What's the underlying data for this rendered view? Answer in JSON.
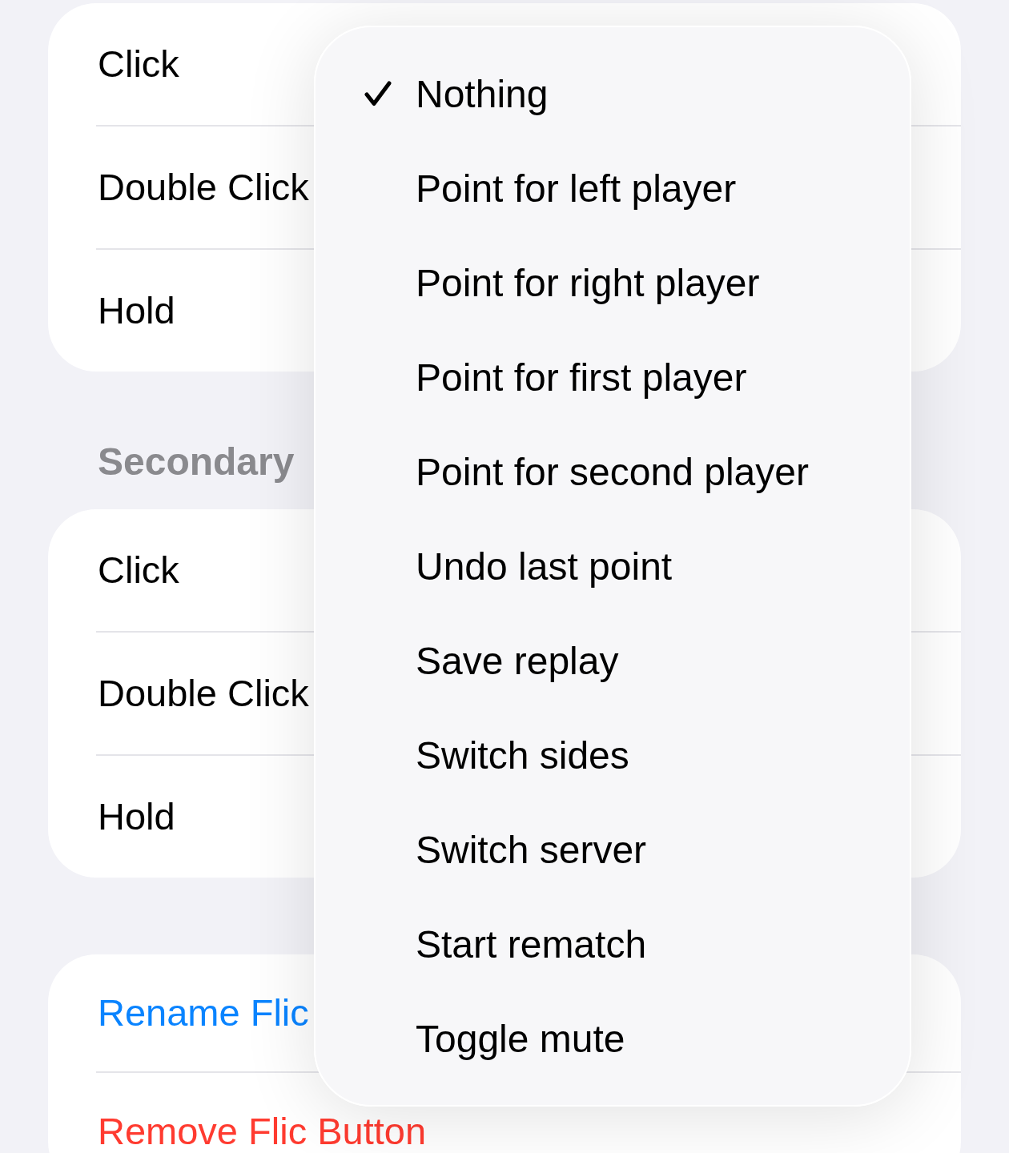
{
  "sections": [
    {
      "rows": [
        {
          "label": "Click",
          "kind": "option"
        },
        {
          "label": "Double Click",
          "kind": "option"
        },
        {
          "label": "Hold",
          "kind": "option"
        }
      ]
    },
    {
      "header": "Secondary",
      "rows": [
        {
          "label": "Click",
          "kind": "option"
        },
        {
          "label": "Double Click",
          "kind": "option"
        },
        {
          "label": "Hold",
          "kind": "option"
        }
      ]
    },
    {
      "rows": [
        {
          "label": "Rename Flic",
          "kind": "action"
        },
        {
          "label": "Remove Flic Button",
          "kind": "destructive"
        }
      ]
    }
  ],
  "menu": {
    "items": [
      {
        "label": "Nothing",
        "selected": true
      },
      {
        "label": "Point for left player",
        "selected": false
      },
      {
        "label": "Point for right player",
        "selected": false
      },
      {
        "label": "Point for first player",
        "selected": false
      },
      {
        "label": "Point for second player",
        "selected": false
      },
      {
        "label": "Undo last point",
        "selected": false
      },
      {
        "label": "Save replay",
        "selected": false
      },
      {
        "label": "Switch sides",
        "selected": false
      },
      {
        "label": "Switch server",
        "selected": false
      },
      {
        "label": "Start rematch",
        "selected": false
      },
      {
        "label": "Toggle mute",
        "selected": false
      }
    ]
  }
}
